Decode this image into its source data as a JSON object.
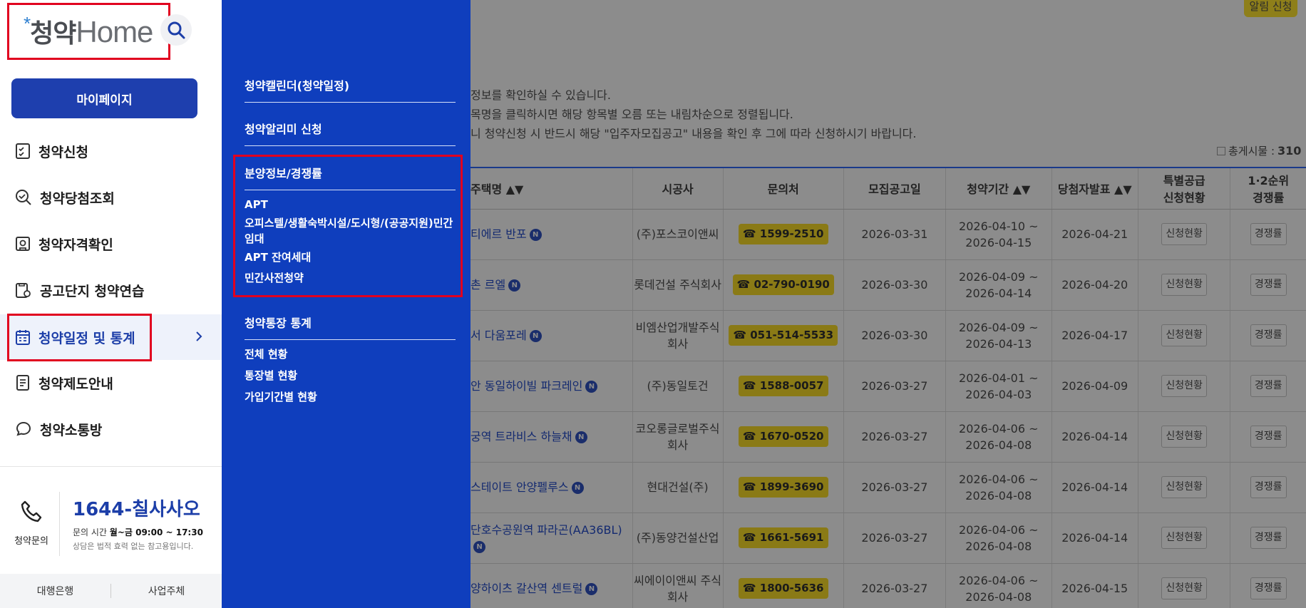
{
  "background": {
    "alert_button": "알림 신청",
    "notices": [
      "정보를 확인하실 수 있습니다.",
      "목명을 클릭하시면 해당 항목별 오름 또는 내림차순으로 정렬됩니다.",
      "니 청약신청 시 반드시 해당 \"입주자모집공고\" 내용을 확인 후 그에 따라 신청하시기 바랍니다."
    ],
    "total_label": "총게시물 :",
    "total_value": "310",
    "columns": [
      "주택명 ▲▼",
      "시공사",
      "문의처",
      "모집공고일",
      "청약기간 ▲▼",
      "당첨자발표 ▲▼",
      "특별공급\n신청현황",
      "1·2순위\n경쟁률"
    ],
    "rows": [
      {
        "name": "티에르 반포",
        "builder": "(주)포스코이앤씨",
        "phone": "☎ 1599-2510",
        "notice": "2026-03-31",
        "period": "2026-04-10 ~ 2026-04-15",
        "winner": "2026-04-21",
        "spec": "신청현황",
        "comp": "경쟁률"
      },
      {
        "name": "촌 르엘",
        "builder": "롯데건설 주식회사",
        "phone": "☎ 02-790-0190",
        "notice": "2026-03-30",
        "period": "2026-04-09 ~ 2026-04-14",
        "winner": "2026-04-20",
        "spec": "신청현황",
        "comp": "경쟁률"
      },
      {
        "name": "서 다움포레",
        "builder": "비엠산업개발주식회사",
        "phone": "☎ 051-514-5533",
        "notice": "2026-03-30",
        "period": "2026-04-09 ~ 2026-04-13",
        "winner": "2026-04-17",
        "spec": "신청현황",
        "comp": "경쟁률"
      },
      {
        "name": "안 동일하이빌 파크레인",
        "builder": "(주)동일토건",
        "phone": "☎ 1588-0057",
        "notice": "2026-03-27",
        "period": "2026-04-01 ~ 2026-04-03",
        "winner": "2026-04-09",
        "spec": "신청현황",
        "comp": "경쟁률"
      },
      {
        "name": "궁역 트라비스 하늘채",
        "builder": "코오롱글로벌주식회사",
        "phone": "☎ 1670-0520",
        "notice": "2026-03-27",
        "period": "2026-04-06 ~ 2026-04-08",
        "winner": "2026-04-14",
        "spec": "신청현황",
        "comp": "경쟁률"
      },
      {
        "name": "스테이트 안양펠루스",
        "builder": "현대건설(주)",
        "phone": "☎ 1899-3690",
        "notice": "2026-03-27",
        "period": "2026-04-06 ~ 2026-04-08",
        "winner": "2026-04-14",
        "spec": "신청현황",
        "comp": "경쟁률"
      },
      {
        "name": "단호수공원역 파라곤(AA36BL)",
        "builder": "(주)동양건설산업",
        "phone": "☎ 1661-5691",
        "notice": "2026-03-27",
        "period": "2026-04-06 ~ 2026-04-08",
        "winner": "2026-04-14",
        "spec": "신청현황",
        "comp": "경쟁률"
      },
      {
        "name": "양하이츠 갈산역 센트럴",
        "builder": "씨에이이앤씨 주식회사",
        "phone": "☎ 1800-5636",
        "notice": "2026-03-27",
        "period": "2026-04-06 ~ 2026-04-08",
        "winner": "2026-04-15",
        "spec": "신청현황",
        "comp": "경쟁률"
      }
    ]
  },
  "drawer": {
    "logo_text": "청약Home",
    "mypage": "마이페이지",
    "menu": [
      {
        "label": "청약신청",
        "icon": "checklist-icon"
      },
      {
        "label": "청약당첨조회",
        "icon": "search-check-icon"
      },
      {
        "label": "청약자격확인",
        "icon": "id-check-icon"
      },
      {
        "label": "공고단지 청약연습",
        "icon": "practice-icon"
      },
      {
        "label": "청약일정 및 통계",
        "icon": "calendar-icon"
      },
      {
        "label": "청약제도안내",
        "icon": "document-icon"
      },
      {
        "label": "청약소통방",
        "icon": "chat-icon"
      }
    ],
    "call": {
      "label": "청약문의",
      "number": "1644-칠사사오",
      "hours_prefix": "문의 시간 ",
      "hours": "월~금 09:00 ~ 17:30",
      "note": "상담은 법적 효력 없는 참고용입니다."
    },
    "bottom": [
      "대행은행",
      "사업주체"
    ]
  },
  "submenu": {
    "sections": [
      {
        "title": "청약캘린더(청약일정)",
        "items": []
      },
      {
        "title": "청약알리미 신청",
        "items": []
      },
      {
        "title": "분양정보/경쟁률",
        "items": [
          "APT",
          "오피스텔/생활숙박시설/도시형/(공공지원)민간임대",
          "APT 잔여세대",
          "민간사전청약"
        ]
      },
      {
        "title": "청약통장 통계",
        "items": [
          "전체 현황",
          "통장별 현황",
          "가입기간별 현황"
        ]
      }
    ]
  },
  "colors": {
    "primary": "#1e3fae",
    "submenu_bg": "#0f3ebd",
    "highlight": "#e1001f"
  }
}
